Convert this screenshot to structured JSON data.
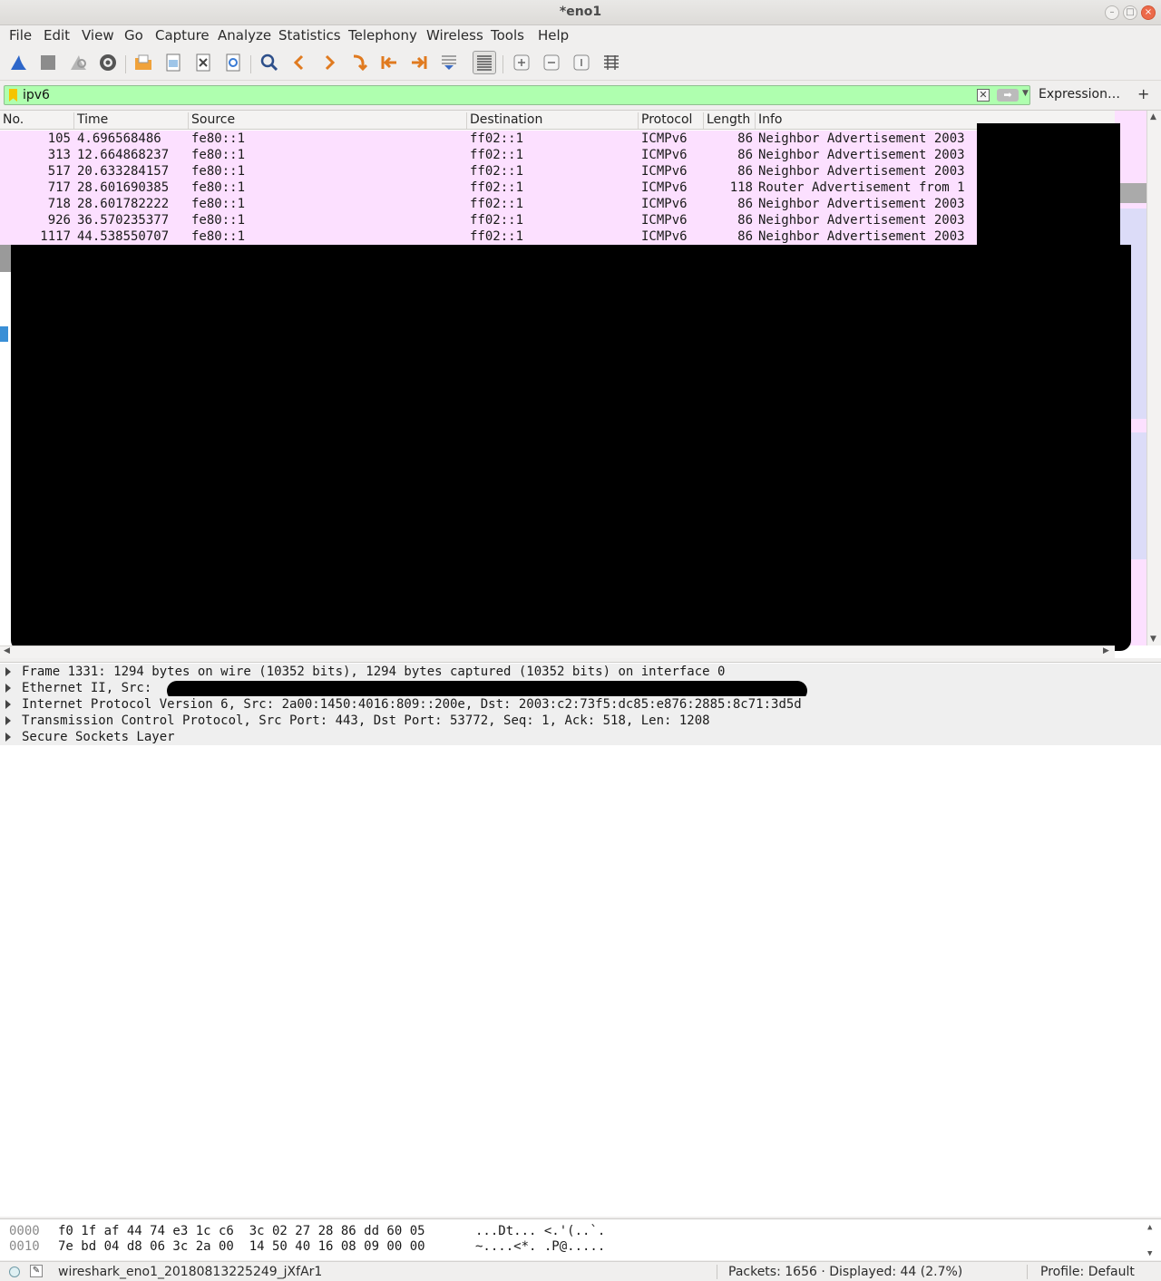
{
  "window": {
    "title": "*eno1",
    "controls": [
      "–",
      "□",
      "×"
    ]
  },
  "menu": [
    "File",
    "Edit",
    "View",
    "Go",
    "Capture",
    "Analyze",
    "Statistics",
    "Telephony",
    "Wireless",
    "Tools",
    "Help"
  ],
  "toolbar": {
    "icons": [
      "shark-fin-start-icon",
      "stop-icon",
      "restart-icon",
      "capture-options-icon",
      "open-folder-icon",
      "save-file-icon",
      "close-file-icon",
      "reload-icon",
      "find-packet-icon",
      "go-back-icon",
      "go-forward-icon",
      "go-to-packet-icon",
      "first-packet-icon",
      "last-packet-icon",
      "autoscroll-icon",
      "colorize-icon",
      "zoom-in-icon",
      "zoom-out-icon",
      "normal-size-icon",
      "resize-columns-icon"
    ]
  },
  "filter": {
    "value": "ipv6",
    "expression_label": "Expression…",
    "add_label": "+"
  },
  "packet_list": {
    "columns": [
      "No.",
      "Time",
      "Source",
      "Destination",
      "Protocol",
      "Length",
      "Info"
    ],
    "rows": [
      {
        "no": "105",
        "time": "4.696568486",
        "source": "fe80::1",
        "destination": "ff02::1",
        "protocol": "ICMPv6",
        "length": "86",
        "info": "Neighbor Advertisement 2003"
      },
      {
        "no": "313",
        "time": "12.664868237",
        "source": "fe80::1",
        "destination": "ff02::1",
        "protocol": "ICMPv6",
        "length": "86",
        "info": "Neighbor Advertisement 2003"
      },
      {
        "no": "517",
        "time": "20.633284157",
        "source": "fe80::1",
        "destination": "ff02::1",
        "protocol": "ICMPv6",
        "length": "86",
        "info": "Neighbor Advertisement 2003"
      },
      {
        "no": "717",
        "time": "28.601690385",
        "source": "fe80::1",
        "destination": "ff02::1",
        "protocol": "ICMPv6",
        "length": "118",
        "info": "Router Advertisement from 1"
      },
      {
        "no": "718",
        "time": "28.601782222",
        "source": "fe80::1",
        "destination": "ff02::1",
        "protocol": "ICMPv6",
        "length": "86",
        "info": "Neighbor Advertisement 2003"
      },
      {
        "no": "926",
        "time": "36.570235377",
        "source": "fe80::1",
        "destination": "ff02::1",
        "protocol": "ICMPv6",
        "length": "86",
        "info": "Neighbor Advertisement 2003"
      },
      {
        "no": "1117",
        "time": "44.538550707",
        "source": "fe80::1",
        "destination": "ff02::1",
        "protocol": "ICMPv6",
        "length": "86",
        "info": "Neighbor Advertisement 2003"
      }
    ]
  },
  "details": [
    "Frame 1331: 1294 bytes on wire (10352 bits), 1294 bytes captured (10352 bits) on interface 0",
    "Ethernet II, Src:",
    "Internet Protocol Version 6, Src: 2a00:1450:4016:809::200e, Dst: 2003:c2:73f5:dc85:e876:2885:8c71:3d5d",
    "Transmission Control Protocol, Src Port: 443, Dst Port: 53772, Seq: 1, Ack: 518, Len: 1208",
    "Secure Sockets Layer"
  ],
  "hex": [
    {
      "offset": "0000",
      "bytes": "f0 1f af 44 74 e3 1c c6  3c 02 27 28 86 dd 60 05",
      "ascii": "...Dt... <.'(..`."
    },
    {
      "offset": "0010",
      "bytes": "7e bd 04 d8 06 3c 2a 00  14 50 40 16 08 09 00 00",
      "ascii": "~....<*. .P@....."
    }
  ],
  "status": {
    "file": "wireshark_eno1_20180813225249_jXfAr1",
    "packets": "Packets: 1656 · Displayed: 44 (2.7%)",
    "profile": "Profile: Default"
  },
  "colors": {
    "row_bg": "#fce0ff",
    "filter_ok": "#afffaf",
    "close_btn": "#ec6a4a"
  }
}
